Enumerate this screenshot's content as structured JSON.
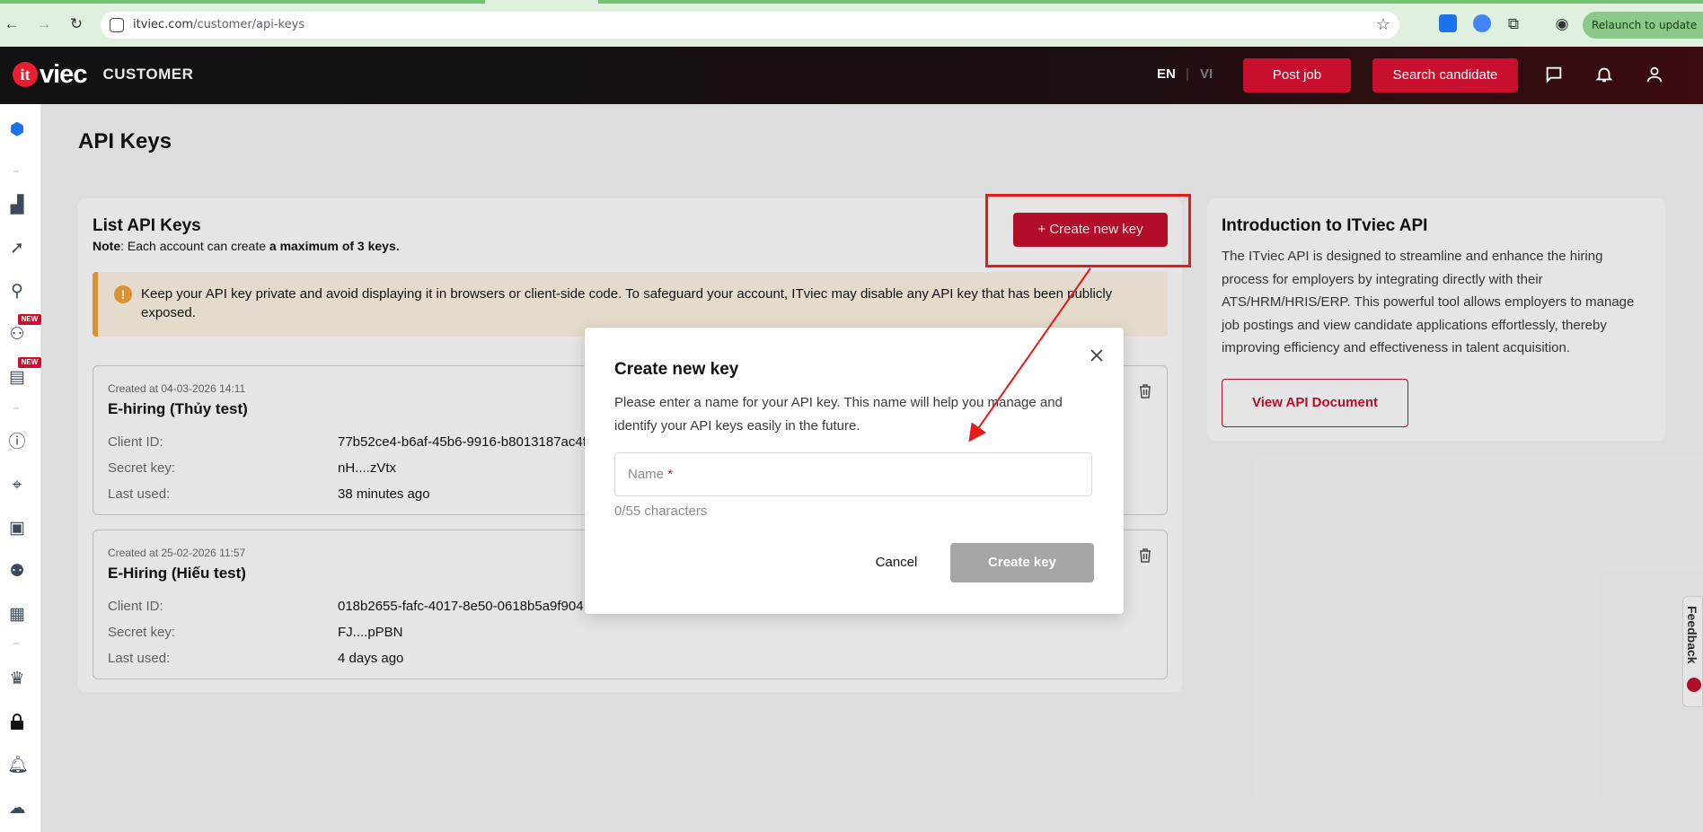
{
  "browser": {
    "url_domain": "itviec.com",
    "url_path": "/customer/api-keys",
    "relaunch_label": "Relaunch to update"
  },
  "header": {
    "logo_it": "it",
    "logo_viec": "viec",
    "section_label": "CUSTOMER",
    "lang_en": "EN",
    "lang_sep": "|",
    "lang_vi": "VI",
    "post_job": "Post job",
    "search_candidate": "Search candidate"
  },
  "sidebar": {
    "new_badge": "NEW"
  },
  "page": {
    "title": "API Keys"
  },
  "list": {
    "title": "List API Keys",
    "note_prefix": "Note",
    "note_text": ": Each account can create ",
    "note_bold": "a maximum of 3 keys.",
    "create_button": "+  Create new key",
    "warning_icon": "!",
    "warning_text": "Keep your API key private and avoid displaying it in browsers or client-side code. To safeguard your account, ITviec may disable any API key that has been publicly exposed.",
    "labels": {
      "client_id": "Client ID:",
      "secret_key": "Secret key:",
      "last_used": "Last used:"
    },
    "keys": [
      {
        "created": "Created at 04-03-2026 14:11",
        "name": "E-hiring (Thủy test)",
        "client_id": "77b52ce4-b6af-45b6-9916-b8013187ac4f",
        "secret_key": "nH....zVtx",
        "last_used": "38 minutes ago"
      },
      {
        "created": "Created at 25-02-2026 11:57",
        "name": "E-Hiring (Hiếu test)",
        "client_id": "018b2655-fafc-4017-8e50-0618b5a9f904",
        "secret_key": "FJ....pPBN",
        "last_used": "4 days ago"
      }
    ]
  },
  "intro": {
    "title": "Introduction to ITviec API",
    "text": "The ITviec API is designed to streamline and enhance the hiring process for employers by integrating directly with their ATS/HRM/HRIS/ERP. This powerful tool allows employers to manage job postings and view candidate applications effortlessly, thereby improving efficiency and effectiveness in talent acquisition.",
    "doc_button": "View API Document"
  },
  "modal": {
    "title": "Create new key",
    "description": "Please enter a name for your API key. This name will help you manage and identify your API keys easily in the future.",
    "name_placeholder": "Name",
    "required_mark": "*",
    "char_count": "0/55 characters",
    "cancel": "Cancel",
    "create": "Create key"
  },
  "feedback": {
    "label": "Feedback"
  },
  "colors": {
    "brand_red": "#c8102e",
    "annotation_red": "#e41b1b",
    "warning_orange": "#f2a33a",
    "disabled_gray": "#a6a6a6"
  }
}
